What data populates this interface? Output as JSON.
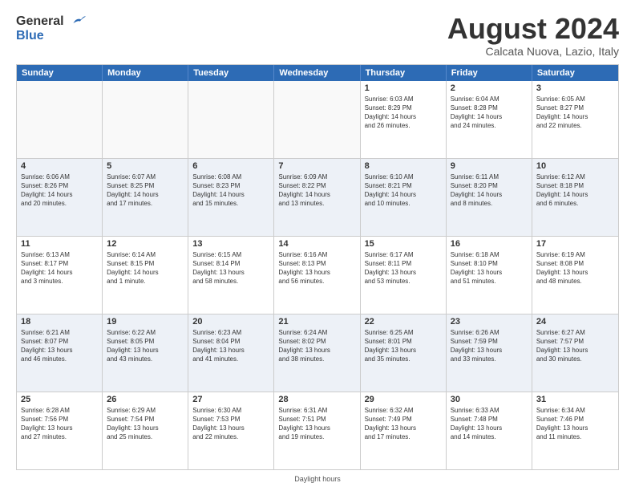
{
  "logo": {
    "text_general": "General",
    "text_blue": "Blue"
  },
  "title": "August 2024",
  "subtitle": "Calcata Nuova, Lazio, Italy",
  "header_days": [
    "Sunday",
    "Monday",
    "Tuesday",
    "Wednesday",
    "Thursday",
    "Friday",
    "Saturday"
  ],
  "rows": [
    [
      {
        "day": "",
        "info": "",
        "empty": true
      },
      {
        "day": "",
        "info": "",
        "empty": true
      },
      {
        "day": "",
        "info": "",
        "empty": true
      },
      {
        "day": "",
        "info": "",
        "empty": true
      },
      {
        "day": "1",
        "info": "Sunrise: 6:03 AM\nSunset: 8:29 PM\nDaylight: 14 hours\nand 26 minutes.",
        "empty": false
      },
      {
        "day": "2",
        "info": "Sunrise: 6:04 AM\nSunset: 8:28 PM\nDaylight: 14 hours\nand 24 minutes.",
        "empty": false
      },
      {
        "day": "3",
        "info": "Sunrise: 6:05 AM\nSunset: 8:27 PM\nDaylight: 14 hours\nand 22 minutes.",
        "empty": false
      }
    ],
    [
      {
        "day": "4",
        "info": "Sunrise: 6:06 AM\nSunset: 8:26 PM\nDaylight: 14 hours\nand 20 minutes.",
        "empty": false
      },
      {
        "day": "5",
        "info": "Sunrise: 6:07 AM\nSunset: 8:25 PM\nDaylight: 14 hours\nand 17 minutes.",
        "empty": false
      },
      {
        "day": "6",
        "info": "Sunrise: 6:08 AM\nSunset: 8:23 PM\nDaylight: 14 hours\nand 15 minutes.",
        "empty": false
      },
      {
        "day": "7",
        "info": "Sunrise: 6:09 AM\nSunset: 8:22 PM\nDaylight: 14 hours\nand 13 minutes.",
        "empty": false
      },
      {
        "day": "8",
        "info": "Sunrise: 6:10 AM\nSunset: 8:21 PM\nDaylight: 14 hours\nand 10 minutes.",
        "empty": false
      },
      {
        "day": "9",
        "info": "Sunrise: 6:11 AM\nSunset: 8:20 PM\nDaylight: 14 hours\nand 8 minutes.",
        "empty": false
      },
      {
        "day": "10",
        "info": "Sunrise: 6:12 AM\nSunset: 8:18 PM\nDaylight: 14 hours\nand 6 minutes.",
        "empty": false
      }
    ],
    [
      {
        "day": "11",
        "info": "Sunrise: 6:13 AM\nSunset: 8:17 PM\nDaylight: 14 hours\nand 3 minutes.",
        "empty": false
      },
      {
        "day": "12",
        "info": "Sunrise: 6:14 AM\nSunset: 8:15 PM\nDaylight: 14 hours\nand 1 minute.",
        "empty": false
      },
      {
        "day": "13",
        "info": "Sunrise: 6:15 AM\nSunset: 8:14 PM\nDaylight: 13 hours\nand 58 minutes.",
        "empty": false
      },
      {
        "day": "14",
        "info": "Sunrise: 6:16 AM\nSunset: 8:13 PM\nDaylight: 13 hours\nand 56 minutes.",
        "empty": false
      },
      {
        "day": "15",
        "info": "Sunrise: 6:17 AM\nSunset: 8:11 PM\nDaylight: 13 hours\nand 53 minutes.",
        "empty": false
      },
      {
        "day": "16",
        "info": "Sunrise: 6:18 AM\nSunset: 8:10 PM\nDaylight: 13 hours\nand 51 minutes.",
        "empty": false
      },
      {
        "day": "17",
        "info": "Sunrise: 6:19 AM\nSunset: 8:08 PM\nDaylight: 13 hours\nand 48 minutes.",
        "empty": false
      }
    ],
    [
      {
        "day": "18",
        "info": "Sunrise: 6:21 AM\nSunset: 8:07 PM\nDaylight: 13 hours\nand 46 minutes.",
        "empty": false
      },
      {
        "day": "19",
        "info": "Sunrise: 6:22 AM\nSunset: 8:05 PM\nDaylight: 13 hours\nand 43 minutes.",
        "empty": false
      },
      {
        "day": "20",
        "info": "Sunrise: 6:23 AM\nSunset: 8:04 PM\nDaylight: 13 hours\nand 41 minutes.",
        "empty": false
      },
      {
        "day": "21",
        "info": "Sunrise: 6:24 AM\nSunset: 8:02 PM\nDaylight: 13 hours\nand 38 minutes.",
        "empty": false
      },
      {
        "day": "22",
        "info": "Sunrise: 6:25 AM\nSunset: 8:01 PM\nDaylight: 13 hours\nand 35 minutes.",
        "empty": false
      },
      {
        "day": "23",
        "info": "Sunrise: 6:26 AM\nSunset: 7:59 PM\nDaylight: 13 hours\nand 33 minutes.",
        "empty": false
      },
      {
        "day": "24",
        "info": "Sunrise: 6:27 AM\nSunset: 7:57 PM\nDaylight: 13 hours\nand 30 minutes.",
        "empty": false
      }
    ],
    [
      {
        "day": "25",
        "info": "Sunrise: 6:28 AM\nSunset: 7:56 PM\nDaylight: 13 hours\nand 27 minutes.",
        "empty": false
      },
      {
        "day": "26",
        "info": "Sunrise: 6:29 AM\nSunset: 7:54 PM\nDaylight: 13 hours\nand 25 minutes.",
        "empty": false
      },
      {
        "day": "27",
        "info": "Sunrise: 6:30 AM\nSunset: 7:53 PM\nDaylight: 13 hours\nand 22 minutes.",
        "empty": false
      },
      {
        "day": "28",
        "info": "Sunrise: 6:31 AM\nSunset: 7:51 PM\nDaylight: 13 hours\nand 19 minutes.",
        "empty": false
      },
      {
        "day": "29",
        "info": "Sunrise: 6:32 AM\nSunset: 7:49 PM\nDaylight: 13 hours\nand 17 minutes.",
        "empty": false
      },
      {
        "day": "30",
        "info": "Sunrise: 6:33 AM\nSunset: 7:48 PM\nDaylight: 13 hours\nand 14 minutes.",
        "empty": false
      },
      {
        "day": "31",
        "info": "Sunrise: 6:34 AM\nSunset: 7:46 PM\nDaylight: 13 hours\nand 11 minutes.",
        "empty": false
      }
    ]
  ],
  "footer": "Daylight hours",
  "alt_rows": [
    1,
    3
  ]
}
